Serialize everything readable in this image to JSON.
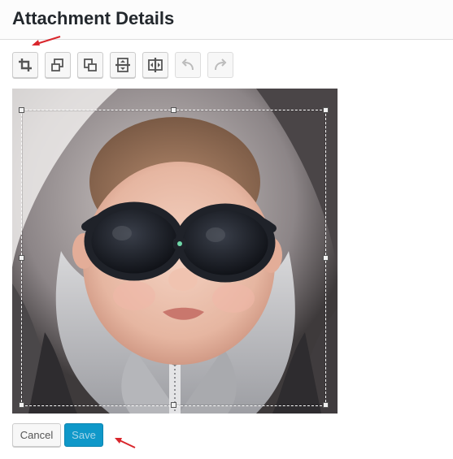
{
  "header": {
    "title": "Attachment Details"
  },
  "toolbar": {
    "buttons": [
      {
        "icon": "crop-icon",
        "enabled": true
      },
      {
        "icon": "rotate-left-icon",
        "enabled": true
      },
      {
        "icon": "rotate-right-icon",
        "enabled": true
      },
      {
        "icon": "flip-vertical-icon",
        "enabled": true
      },
      {
        "icon": "flip-horizontal-icon",
        "enabled": true
      },
      {
        "icon": "undo-icon",
        "enabled": false
      },
      {
        "icon": "redo-icon",
        "enabled": false
      }
    ]
  },
  "actions": {
    "cancel_label": "Cancel",
    "save_label": "Save"
  },
  "colors": {
    "accent": "#0f98c9",
    "annotation_arrow": "#d9262c"
  }
}
